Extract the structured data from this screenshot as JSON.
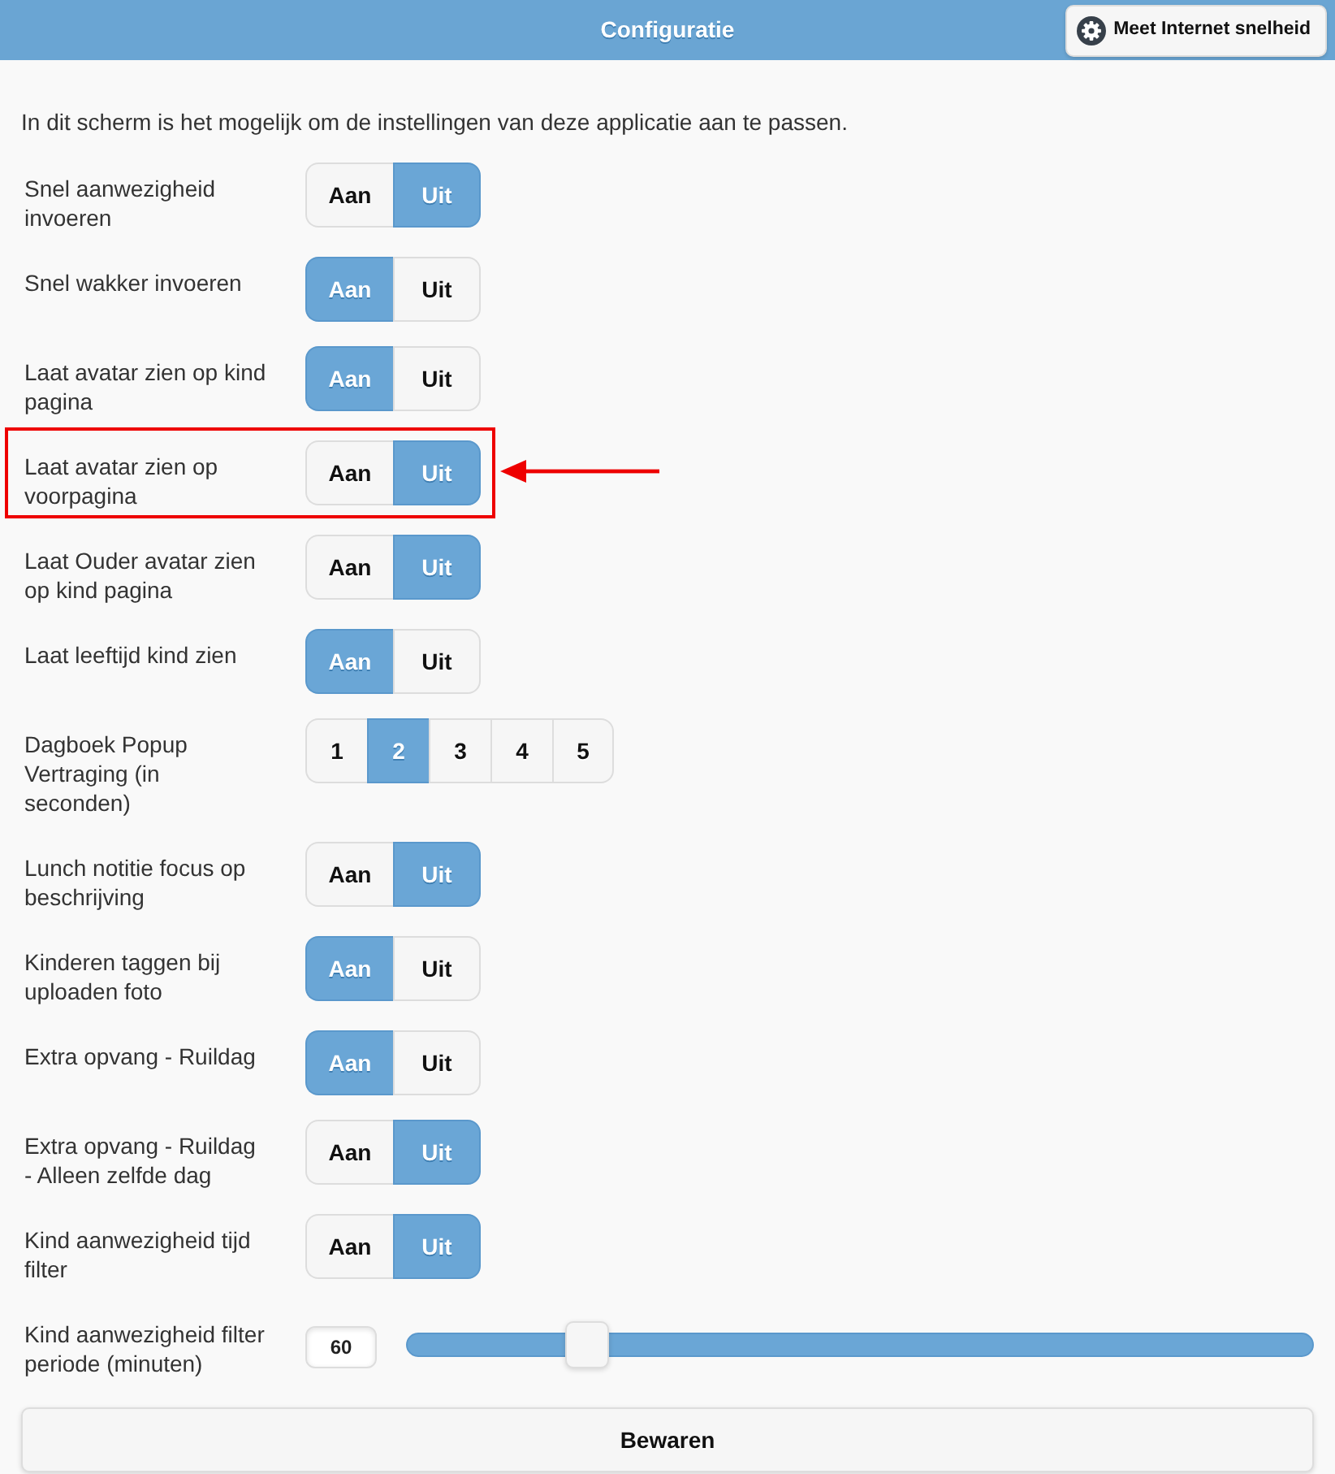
{
  "header": {
    "title": "Configuratie",
    "action": {
      "label": "Meet Internet snelheid"
    }
  },
  "intro": "In dit scherm is het mogelijk om de instellingen van deze applicatie aan te passen.",
  "settings": [
    {
      "kind": "toggle",
      "label": "Snel aanwezigheid invoeren",
      "highlighted": false,
      "options": [
        {
          "label": "Aan",
          "selected": false
        },
        {
          "label": "Uit",
          "selected": true
        }
      ]
    },
    {
      "kind": "toggle",
      "label": "Snel wakker invoeren",
      "highlighted": false,
      "options": [
        {
          "label": "Aan",
          "selected": true
        },
        {
          "label": "Uit",
          "selected": false
        }
      ]
    },
    {
      "kind": "toggle",
      "label": "Laat avatar zien op kind pagina",
      "highlighted": false,
      "options": [
        {
          "label": "Aan",
          "selected": true
        },
        {
          "label": "Uit",
          "selected": false
        }
      ]
    },
    {
      "kind": "toggle",
      "label": "Laat avatar zien op voorpagina",
      "highlighted": true,
      "options": [
        {
          "label": "Aan",
          "selected": false
        },
        {
          "label": "Uit",
          "selected": true
        }
      ]
    },
    {
      "kind": "toggle",
      "label": "Laat Ouder avatar zien op kind pagina",
      "highlighted": false,
      "options": [
        {
          "label": "Aan",
          "selected": false
        },
        {
          "label": "Uit",
          "selected": true
        }
      ]
    },
    {
      "kind": "toggle",
      "label": "Laat leeftijd kind zien",
      "highlighted": false,
      "options": [
        {
          "label": "Aan",
          "selected": true
        },
        {
          "label": "Uit",
          "selected": false
        }
      ]
    },
    {
      "kind": "choice",
      "label": "Dagboek Popup Vertraging (in seconden)",
      "highlighted": false,
      "options": [
        {
          "label": "1",
          "selected": false
        },
        {
          "label": "2",
          "selected": true
        },
        {
          "label": "3",
          "selected": false
        },
        {
          "label": "4",
          "selected": false
        },
        {
          "label": "5",
          "selected": false
        }
      ]
    },
    {
      "kind": "toggle",
      "label": "Lunch notitie focus op beschrijving",
      "highlighted": false,
      "options": [
        {
          "label": "Aan",
          "selected": false
        },
        {
          "label": "Uit",
          "selected": true
        }
      ]
    },
    {
      "kind": "toggle",
      "label": "Kinderen taggen bij uploaden foto",
      "highlighted": false,
      "options": [
        {
          "label": "Aan",
          "selected": true
        },
        {
          "label": "Uit",
          "selected": false
        }
      ]
    },
    {
      "kind": "toggle",
      "label": "Extra opvang - Ruildag",
      "highlighted": false,
      "options": [
        {
          "label": "Aan",
          "selected": true
        },
        {
          "label": "Uit",
          "selected": false
        }
      ]
    },
    {
      "kind": "toggle",
      "label": "Extra opvang - Ruildag - Alleen zelfde dag",
      "highlighted": false,
      "options": [
        {
          "label": "Aan",
          "selected": false
        },
        {
          "label": "Uit",
          "selected": true
        }
      ]
    },
    {
      "kind": "toggle",
      "label": "Kind aanwezigheid tijd filter",
      "highlighted": false,
      "options": [
        {
          "label": "Aan",
          "selected": false
        },
        {
          "label": "Uit",
          "selected": true
        }
      ]
    },
    {
      "kind": "slider",
      "label": "Kind aanwezigheid filter periode (minuten)",
      "highlighted": false,
      "value": "60",
      "level": 0.2
    }
  ],
  "save_button": {
    "label": "Bewaren"
  }
}
